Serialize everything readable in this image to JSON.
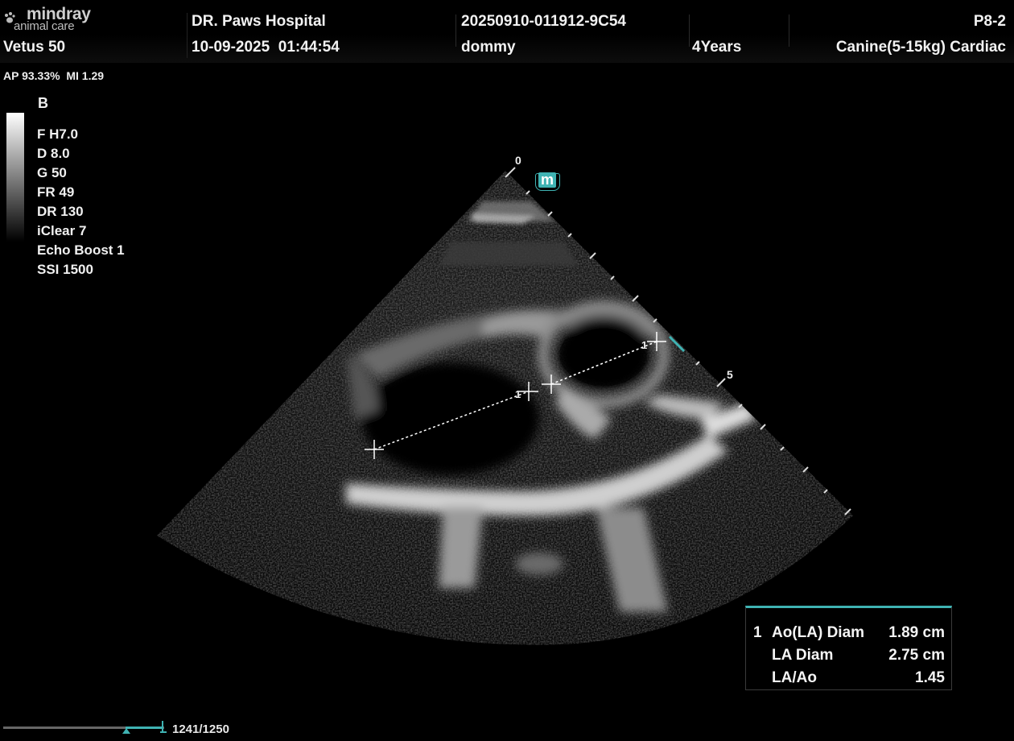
{
  "header": {
    "logo_brand": "mindray",
    "logo_sub": "animal care",
    "model": "Vetus 50",
    "hospital": "DR. Paws Hospital",
    "datetime": "10-09-2025  01:44:54",
    "exam_id": "20250910-011912-9C54",
    "patient_name": "dommy",
    "age": "4Years",
    "probe": "P8-2",
    "preset": "Canine(5-15kg) Cardiac"
  },
  "status": {
    "ap_mi": "AP 93.33%  MI 1.29"
  },
  "imaging_params": {
    "mode": "B",
    "items": [
      "F H7.0",
      "D 8.0",
      "G 50",
      "FR 49",
      "DR 130",
      "iClear 7",
      "Echo Boost 1",
      "SSI 1500"
    ]
  },
  "depth_scale": {
    "top_label": "0",
    "mid_label": "5",
    "marker_label": "m"
  },
  "measurements": {
    "index": "1",
    "rows": [
      {
        "label": "Ao(LA) Diam",
        "value": "1.89 cm"
      },
      {
        "label": "LA Diam",
        "value": "2.75 cm"
      },
      {
        "label": "LA/Ao",
        "value": "1.45"
      }
    ]
  },
  "caliper_labels": [
    "1",
    "1"
  ],
  "cine": {
    "frame_count": "1241/1250",
    "position_fraction": 0.993
  },
  "colors": {
    "accent": "#3fb3b3",
    "text": "#f2f2f2"
  }
}
